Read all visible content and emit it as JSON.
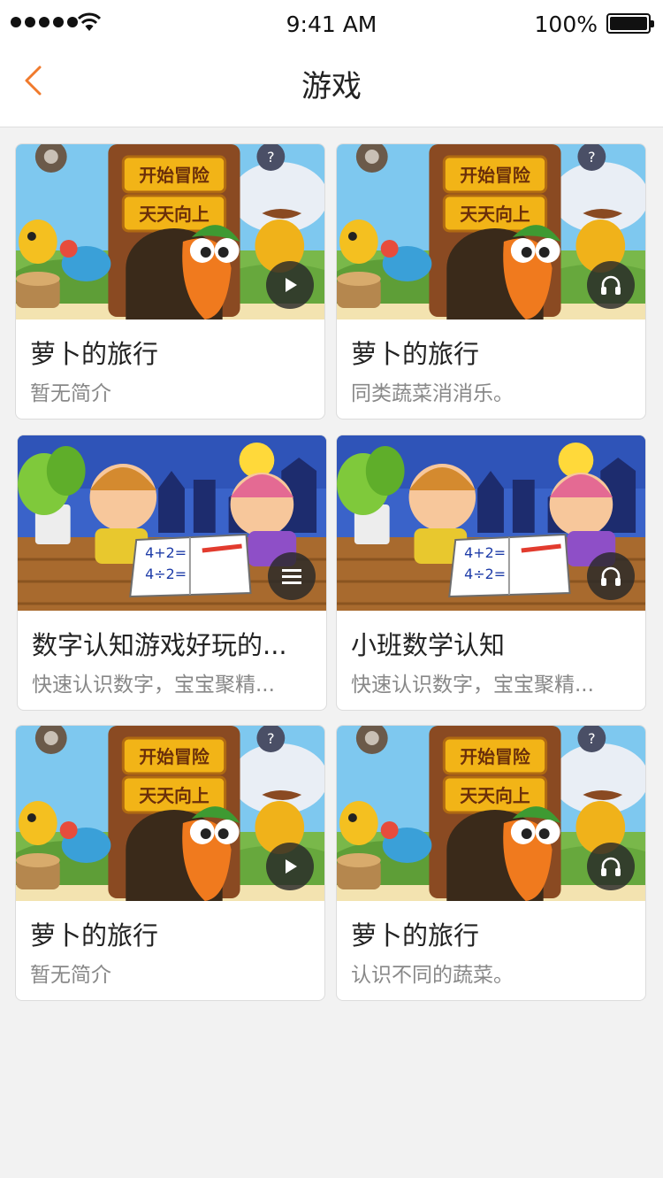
{
  "status_bar": {
    "time": "9:41 AM",
    "battery": "100%",
    "icons": [
      "signal-icon",
      "wifi-icon",
      "battery-icon"
    ]
  },
  "nav": {
    "title": "游戏",
    "back_icon": "chevron-left-icon",
    "accent_color": "#f07a2c"
  },
  "cards": [
    {
      "title": "萝卜的旅行",
      "desc": "暂无简介",
      "thumbnail": "carrot-adventure",
      "sign1": "开始冒险",
      "sign2": "天天向上",
      "media_icon": "play-icon"
    },
    {
      "title": "萝卜的旅行",
      "desc": "同类蔬菜消消乐。",
      "thumbnail": "carrot-adventure",
      "sign1": "开始冒险",
      "sign2": "天天向上",
      "media_icon": "headphones-icon"
    },
    {
      "title": "数字认知游戏好玩的...",
      "desc": "快速认识数字，宝宝聚精...",
      "thumbnail": "kids-math",
      "eq1": "4+2=",
      "eq2": "4÷2=",
      "media_icon": "list-icon"
    },
    {
      "title": "小班数学认知",
      "desc": "快速认识数字，宝宝聚精...",
      "thumbnail": "kids-math",
      "eq1": "4+2=",
      "eq2": "4÷2=",
      "media_icon": "headphones-icon"
    },
    {
      "title": "萝卜的旅行",
      "desc": "暂无简介",
      "thumbnail": "carrot-adventure",
      "sign1": "开始冒险",
      "sign2": "天天向上",
      "media_icon": "play-icon"
    },
    {
      "title": "萝卜的旅行",
      "desc": "认识不同的蔬菜。",
      "thumbnail": "carrot-adventure",
      "sign1": "开始冒险",
      "sign2": "天天向上",
      "media_icon": "headphones-icon"
    }
  ]
}
